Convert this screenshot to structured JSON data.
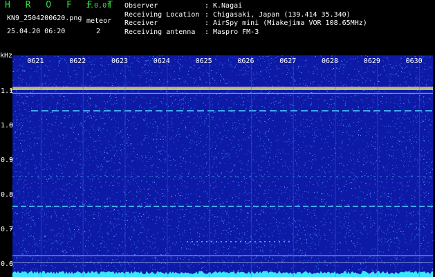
{
  "header": {
    "app_name": "H R O F F T",
    "version": "1.0.0f",
    "filename": "KN9_2504200620.png",
    "timestamp": "25.04.20 06:20",
    "meteor_label": "meteor",
    "meteor_count": "2"
  },
  "info": [
    {
      "key": "Observer",
      "sep": ":",
      "value": "K.Nagai"
    },
    {
      "key": "Receiving Location",
      "sep": ":",
      "value": "Chigasaki, Japan (139.414 35.340)"
    },
    {
      "key": "Receiver",
      "sep": ":",
      "value": "AirSpy mini (Miakejima VOR 108.65MHz)"
    },
    {
      "key": "Receiving antenna",
      "sep": ":",
      "value": "Maspro FM-3"
    }
  ],
  "spectrogram": {
    "y_unit": "kHz",
    "y_ticks": [
      "1.1",
      "1.0",
      "0.9",
      "0.8",
      "0.7",
      "0.6"
    ],
    "x_ticks": [
      "0621",
      "0622",
      "0623",
      "0624",
      "0625",
      "0626",
      "0627",
      "0628",
      "0629",
      "0630"
    ],
    "colors": {
      "background": "#0d1aa6",
      "noise": "#3b6cff",
      "carrier": "#cfe060",
      "line": "#4fd8ff",
      "floor": "#39e6ff"
    }
  }
}
